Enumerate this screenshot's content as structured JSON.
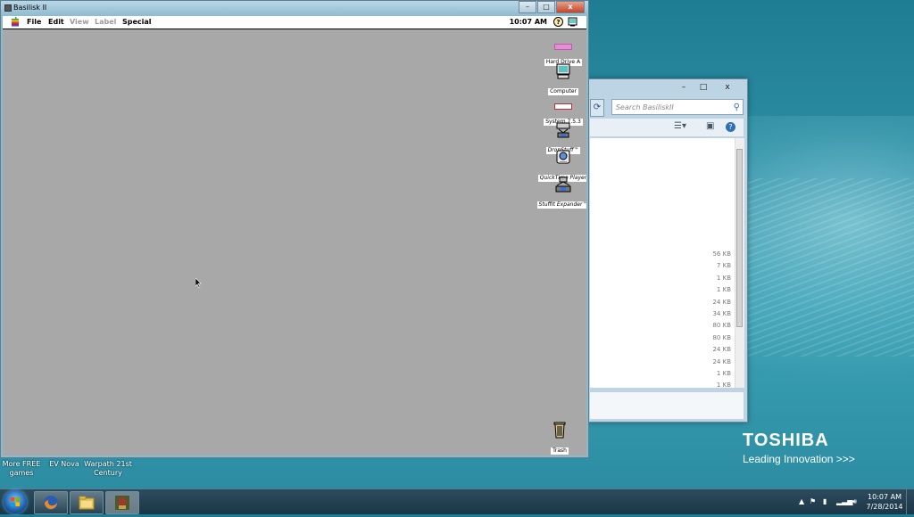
{
  "basilisk": {
    "title": "Basilisk II",
    "controls": {
      "minimize": "–",
      "maximize": "□",
      "close": "x"
    }
  },
  "mac": {
    "menu": [
      "File",
      "Edit",
      "View",
      "Label",
      "Special"
    ],
    "clock": "10:07 AM",
    "help": "?",
    "desktop_icons": [
      {
        "label": "Hard Drive A"
      },
      {
        "label": "Computer"
      },
      {
        "label": "System 7.5.3"
      },
      {
        "label": "DropStuff™"
      },
      {
        "label": "QuickTime Player"
      },
      {
        "label": "StuffIt Expander™"
      }
    ],
    "trash": "Trash"
  },
  "explorer": {
    "search_placeholder": "Search BasiliskII",
    "controls": {
      "minimize": "–",
      "maximize": "□",
      "close": "x"
    },
    "sizes": [
      "56 KB",
      "7 KB",
      "1 KB",
      "1 KB",
      "24 KB",
      "34 KB",
      "80 KB",
      "80 KB",
      "24 KB",
      "24 KB",
      "1 KB",
      "1 KB"
    ]
  },
  "wallpaper": {
    "brand": "TOSHIBA",
    "tagline": "Leading Innovation",
    "tagline_arrows": ">>>"
  },
  "desktop": {
    "shortcuts": [
      {
        "label": "More FREE games"
      },
      {
        "label": "EV Nova"
      },
      {
        "label": "Warpath 21st Century"
      }
    ]
  },
  "taskbar": {
    "time": "10:07 AM",
    "date": "7/28/2014"
  }
}
